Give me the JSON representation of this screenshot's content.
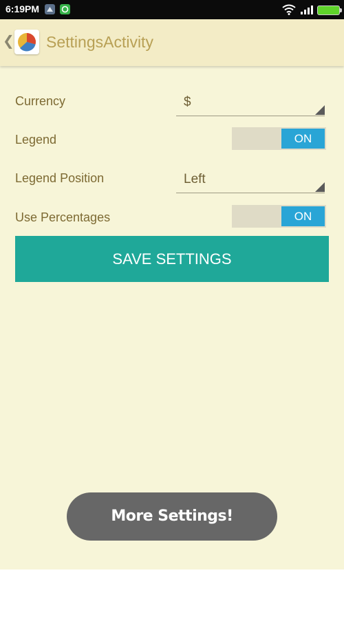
{
  "status_bar": {
    "time": "6:19PM",
    "icons": [
      "notification-icon",
      "sync-icon",
      "wifi-icon",
      "signal-icon",
      "battery-icon"
    ]
  },
  "action_bar": {
    "title": "SettingsActivity",
    "back_icon": "chevron-left-icon",
    "app_icon": "pie-chart-icon"
  },
  "settings": {
    "currency": {
      "label": "Currency",
      "value": "$"
    },
    "legend": {
      "label": "Legend",
      "state": "ON"
    },
    "legend_position": {
      "label": "Legend Position",
      "value": "Left"
    },
    "use_percentages": {
      "label": "Use Percentages",
      "state": "ON"
    }
  },
  "save_button": {
    "label": "SAVE SETTINGS"
  },
  "toast": {
    "text": "More Settings!"
  },
  "colors": {
    "background": "#f7f5d8",
    "action_bar": "#f3ecc6",
    "label_text": "#7d6a33",
    "toggle_on": "#29a5d6",
    "save_button": "#1fa899",
    "toast": "#676767"
  }
}
